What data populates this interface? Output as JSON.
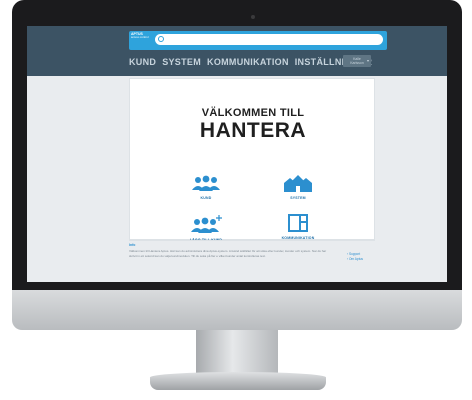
{
  "app": {
    "logo_text": "APTUS",
    "logo_sub": "access control",
    "brand_color": "#2ea3dc",
    "topbar_color": "#3c5364"
  },
  "search": {
    "placeholder": ""
  },
  "nav": {
    "items": [
      {
        "label": "KUND"
      },
      {
        "label": "SYSTEM"
      },
      {
        "label": "KOMMUNIKATION"
      },
      {
        "label": "INSTÄLLNINGAR"
      }
    ],
    "user_button": {
      "line1": "Kalle",
      "line2": "Karlsson"
    }
  },
  "welcome": {
    "line1": "VÄLKOMMEN TILL",
    "line2": "HANTERA"
  },
  "tiles": [
    {
      "label": "KUND",
      "icon": "users-icon"
    },
    {
      "label": "SYSTEM",
      "icon": "buildings-icon"
    },
    {
      "label": "LÄGG TILL KUND",
      "icon": "add-user-icon"
    },
    {
      "label": "KOMMUNIKATION",
      "icon": "communication-icon"
    }
  ],
  "info": {
    "title": "Info",
    "text": "Välkommen till Hantera Aptus. Här kan du administrera dina Aptus-system. Använd sökfältet för att söka efter kunder, kunder och system. Nar du har skrivit in ett sokord kan du valja kundmodulen. Till du soka på fler e vilket kunder antal kontrolleras text.",
    "links": [
      "› Support",
      "› Om Aptus"
    ]
  }
}
